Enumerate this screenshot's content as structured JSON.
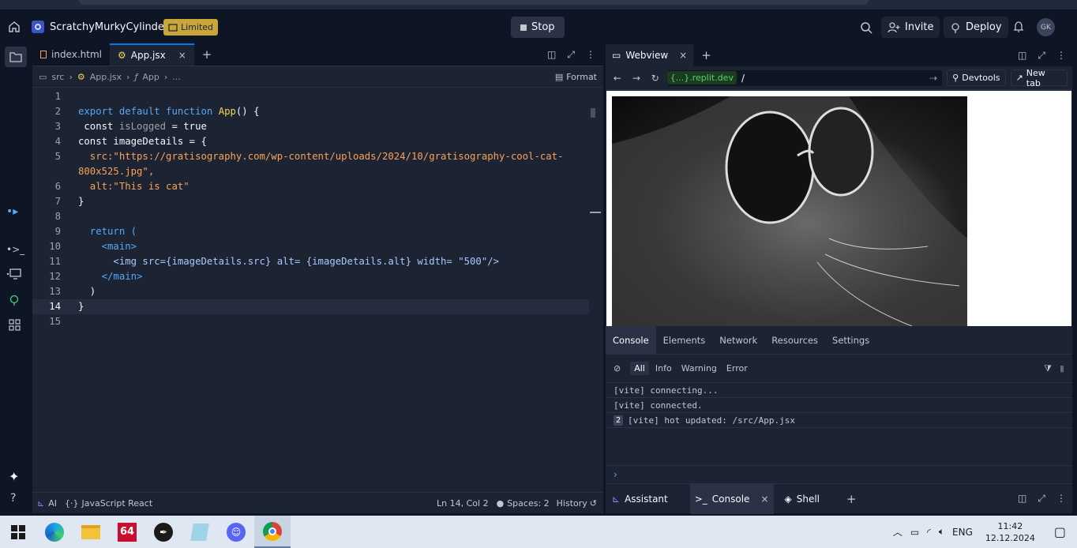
{
  "project": {
    "name": "ScratchyMurkyCylinders",
    "badge": "Limited"
  },
  "header": {
    "stop_label": "Stop",
    "invite_label": "Invite",
    "deploy_label": "Deploy",
    "avatar_initials": "GK"
  },
  "editor": {
    "tabs": [
      {
        "label": "index.html"
      },
      {
        "label": "App.jsx"
      }
    ],
    "breadcrumb": [
      "src",
      "App.jsx",
      "App",
      "..."
    ],
    "format_label": "Format",
    "lines": [
      {
        "n": "1",
        "text": ""
      },
      {
        "n": "2",
        "text": "export default function App() {"
      },
      {
        "n": "3",
        "text": " const isLogged = true"
      },
      {
        "n": "4",
        "text": "const imageDetails = {"
      },
      {
        "n": "5",
        "text": "  src:\"https://gratisography.com/wp-content/uploads/2024/10/gratisography-cool-cat-"
      },
      {
        "n": "",
        "text": "800x525.jpg\","
      },
      {
        "n": "6",
        "text": "  alt:\"This is cat\""
      },
      {
        "n": "7",
        "text": "}"
      },
      {
        "n": "8",
        "text": ""
      },
      {
        "n": "9",
        "text": "  return ("
      },
      {
        "n": "10",
        "text": "    <main>"
      },
      {
        "n": "11",
        "text": "      <img src={imageDetails.src} alt= {imageDetails.alt} width= \"500\"/>"
      },
      {
        "n": "12",
        "text": "    </main>"
      },
      {
        "n": "13",
        "text": "  )"
      },
      {
        "n": "14",
        "text": "}"
      },
      {
        "n": "15",
        "text": ""
      }
    ],
    "status": {
      "ai": "AI",
      "language": "JavaScript React",
      "position": "Ln 14, Col 2",
      "spaces": "Spaces: 2",
      "history": "History"
    }
  },
  "webview": {
    "tab_label": "Webview",
    "url_host": "{...}.replit.dev",
    "url_path": "/",
    "devtools_label": "Devtools",
    "newtab_label": "New tab",
    "image_alt": "This is cat"
  },
  "console": {
    "tabs": [
      "Console",
      "Elements",
      "Network",
      "Resources",
      "Settings"
    ],
    "filters": [
      "All",
      "Info",
      "Warning",
      "Error"
    ],
    "logs": [
      {
        "count": "",
        "text": "[vite] connecting..."
      },
      {
        "count": "",
        "text": "[vite] connected."
      },
      {
        "count": "2",
        "text": "[vite] hot updated: /src/App.jsx"
      }
    ]
  },
  "bottom_tabs": [
    "Assistant",
    "Console",
    "Shell"
  ],
  "taskbar": {
    "lang": "ENG",
    "time": "11:42",
    "date": "12.12.2024",
    "app_badge": "64"
  },
  "colors": {
    "bg": "#0e1525",
    "panel": "#1c2333",
    "accent": "#0079f2",
    "badge": "#c9a53a"
  }
}
